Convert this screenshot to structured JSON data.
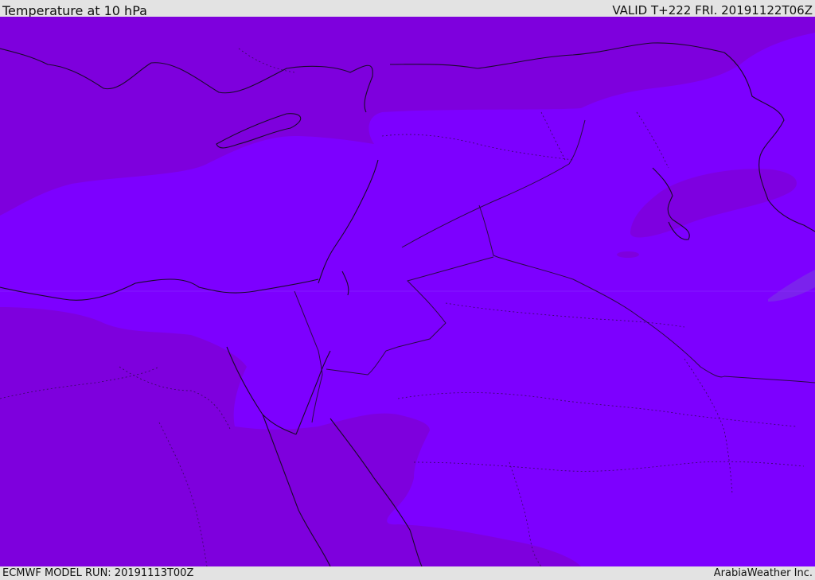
{
  "header": {
    "title": "Temperature at 10 hPa",
    "valid": "VALID T+222 FRI. 20191122T06Z"
  },
  "footer": {
    "model_run": "ECMWF MODEL RUN: 20191113T00Z",
    "credit": "ArabiaWeather Inc."
  },
  "map": {
    "colors": {
      "cold_band": "#7e00dd",
      "warm_band": "#7d00ff",
      "anomaly": "#7a2be8",
      "coast": "#1a0a2a",
      "border": "#2a0a45"
    },
    "fill_levels": [
      {
        "name": "darker-violet",
        "color": "#7e00dd"
      },
      {
        "name": "bright-violet",
        "color": "#7d00ff"
      }
    ]
  }
}
